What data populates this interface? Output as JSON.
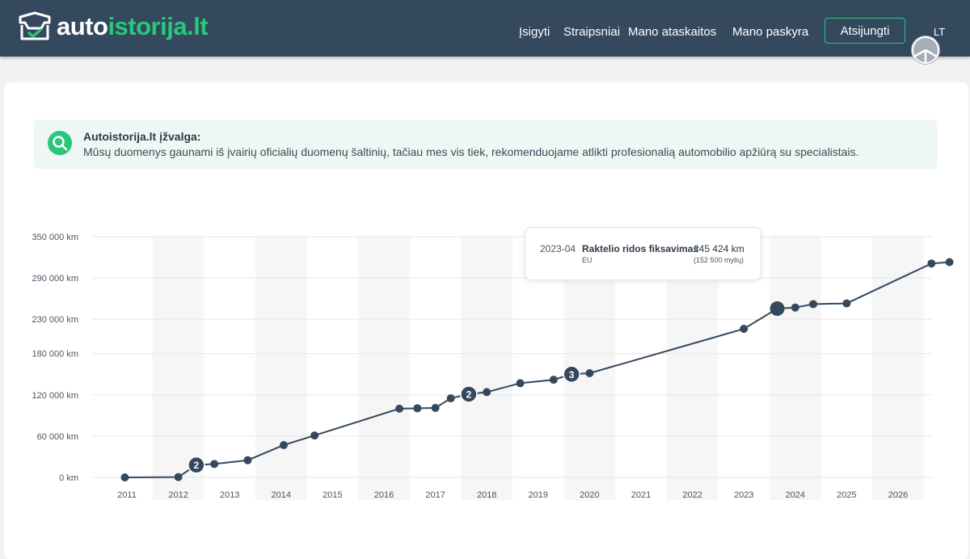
{
  "header": {
    "logo": {
      "part1": "auto",
      "part2": "istorija.lt"
    },
    "nav": [
      "Įsigyti",
      "Straipsniai",
      "Mano ataskaitos",
      "Mano paskyra"
    ],
    "logout_label": "Atsijungti",
    "language": "LT"
  },
  "insight": {
    "title": "Autoistorija.lt įžvalga:",
    "text": "Mūsų duomenys gaunami iš įvairių oficialių duomenų šaltinių, tačiau mes vis tiek, rekomenduojame atlikti profesionalią automobilio apžiūrą su specialistais."
  },
  "tooltip": {
    "date": "2023-04",
    "event": "Raktelio ridos fiksavimas",
    "region": "EU",
    "km": "245 424 km",
    "miles": "(152 500 mylių)"
  },
  "chart_data": {
    "type": "line",
    "x_unit": "year",
    "xlim": [
      2010.75,
      2027.0
    ],
    "ylim": [
      0,
      350000
    ],
    "y_ticks": [
      {
        "value": 0,
        "label": "0 km"
      },
      {
        "value": 60000,
        "label": "60 000 km"
      },
      {
        "value": 120000,
        "label": "120 000 km"
      },
      {
        "value": 180000,
        "label": "180 000 km"
      },
      {
        "value": 230000,
        "label": "230 000 km"
      },
      {
        "value": 290000,
        "label": "290 000 km"
      },
      {
        "value": 350000,
        "label": "350 000 km"
      }
    ],
    "x_ticks": [
      "2011",
      "2012",
      "2013",
      "2014",
      "2015",
      "2016",
      "2017",
      "2018",
      "2019",
      "2020",
      "2021",
      "2022",
      "2023",
      "2024",
      "2025",
      "2026"
    ],
    "shaded_years": [
      2012,
      2014,
      2016,
      2018,
      2020,
      2022,
      2024,
      2026
    ],
    "grid": true,
    "points": [
      {
        "x": 2010.96,
        "y": 0
      },
      {
        "x": 2012.0,
        "y": 500
      },
      {
        "x": 2012.35,
        "y": 18000,
        "count": "2"
      },
      {
        "x": 2012.7,
        "y": 19500
      },
      {
        "x": 2013.35,
        "y": 25000
      },
      {
        "x": 2014.05,
        "y": 47000
      },
      {
        "x": 2014.65,
        "y": 61000
      },
      {
        "x": 2016.3,
        "y": 100000
      },
      {
        "x": 2016.65,
        "y": 100500
      },
      {
        "x": 2017.0,
        "y": 101000
      },
      {
        "x": 2017.3,
        "y": 115000
      },
      {
        "x": 2017.65,
        "y": 121000,
        "count": "2"
      },
      {
        "x": 2018.0,
        "y": 124000
      },
      {
        "x": 2018.65,
        "y": 137000
      },
      {
        "x": 2019.3,
        "y": 142000
      },
      {
        "x": 2019.65,
        "y": 150000,
        "count": "3"
      },
      {
        "x": 2020.0,
        "y": 151500
      },
      {
        "x": 2023.0,
        "y": 216000
      },
      {
        "x": 2023.65,
        "y": 245424,
        "highlight": true
      },
      {
        "x": 2024.0,
        "y": 247000
      },
      {
        "x": 2024.35,
        "y": 252000
      },
      {
        "x": 2025.0,
        "y": 253000
      },
      {
        "x": 2026.65,
        "y": 311000
      },
      {
        "x": 2027.0,
        "y": 313000
      }
    ]
  },
  "colors": {
    "header_bg": "#34495e",
    "accent": "#29c77b",
    "line": "#34495e"
  }
}
